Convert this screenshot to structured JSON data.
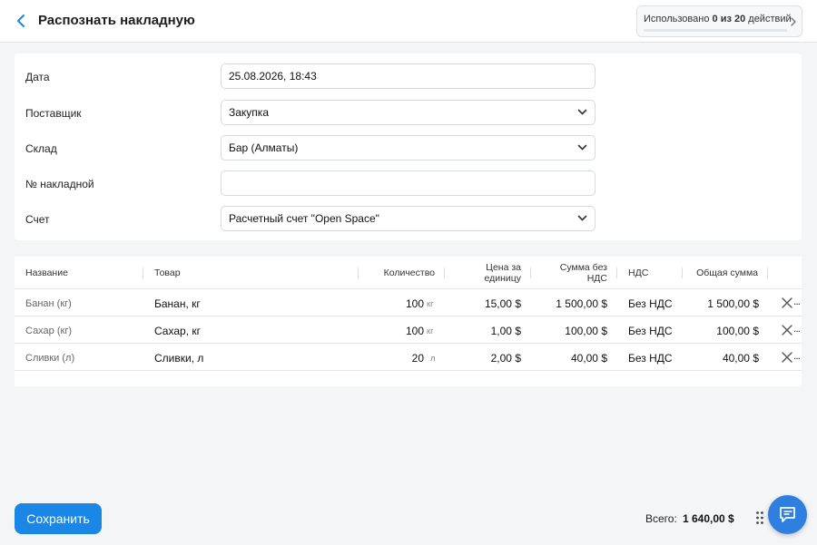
{
  "header": {
    "title": "Распознать накладную",
    "usage": {
      "prefix": "Использовано ",
      "used": "0 из 20",
      "suffix": " действий",
      "progress": 0
    }
  },
  "form": {
    "date": {
      "label": "Дата",
      "value": "25.08.2026, 18:43"
    },
    "supplier": {
      "label": "Поставщик",
      "value": "Закупка"
    },
    "warehouse": {
      "label": "Склад",
      "value": "Бар (Алматы)"
    },
    "invoice_number": {
      "label": "№ накладной",
      "value": ""
    },
    "account": {
      "label": "Счет",
      "value": "Расчетный счет \"Open Space\""
    }
  },
  "table": {
    "headers": {
      "name": "Название",
      "product": "Товар",
      "quantity": "Количество",
      "price_1": "Цена за",
      "price_2": "единицу",
      "sum_1": "Сумма без",
      "sum_2": "НДС",
      "vat": "НДС",
      "total": "Общая сумма"
    },
    "rows": [
      {
        "name": "Банан (кг)",
        "product": "Банан, кг",
        "quantity": "100",
        "unit": "кг",
        "price": "15,00 $",
        "sum_no_vat": "1 500,00 $",
        "vat": "Без НДС",
        "total": "1 500,00 $"
      },
      {
        "name": "Сахар (кг)",
        "product": "Сахар, кг",
        "quantity": "100",
        "unit": "кг",
        "price": "1,00 $",
        "sum_no_vat": "100,00 $",
        "vat": "Без НДС",
        "total": "100,00 $"
      },
      {
        "name": "Сливки (л)",
        "product": "Сливки, л",
        "quantity": "20",
        "unit": "л",
        "price": "2,00 $",
        "sum_no_vat": "40,00 $",
        "vat": "Без НДС",
        "total": "40,00 $"
      }
    ],
    "more_label": "..."
  },
  "footer": {
    "save_label": "Сохранить",
    "total_label": "Всего:",
    "total_value": "1 640,00 $"
  },
  "icons": {
    "back": "chevron-left-icon",
    "usage": "chevron-right-icon",
    "select": "chevron-down-icon",
    "delete": "close-icon",
    "drag": "drag-handle-icon",
    "chat": "chat-icon"
  },
  "colors": {
    "accent": "#1a87e6",
    "chat": "#2f7fe0"
  }
}
